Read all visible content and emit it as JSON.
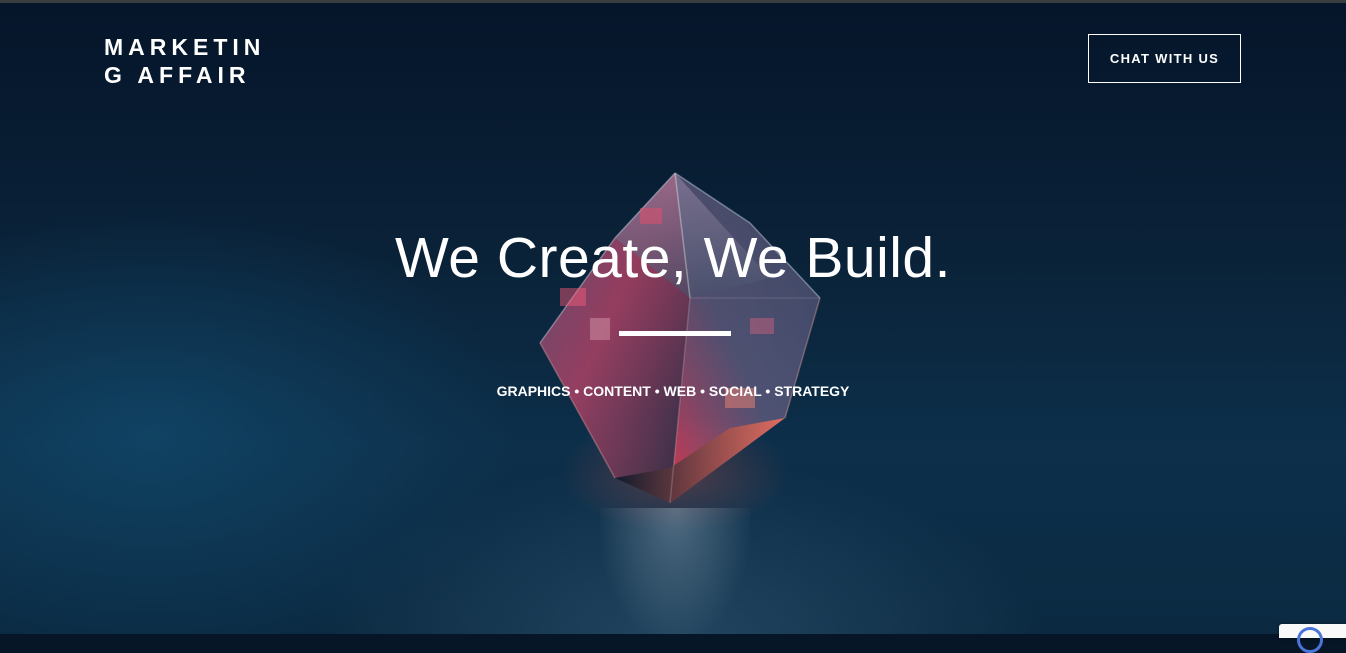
{
  "header": {
    "logo_text": "MARKETING AFFAIR",
    "cta_label": "CHAT WITH US"
  },
  "hero": {
    "headline": "We Create, We Build.",
    "services": "GRAPHICS • CONTENT • WEB • SOCIAL • STRATEGY"
  },
  "colors": {
    "background": "#061627",
    "text": "#ffffff",
    "cube_accent": "#e8334f"
  },
  "icons": {
    "recaptcha": "recaptcha-icon"
  }
}
